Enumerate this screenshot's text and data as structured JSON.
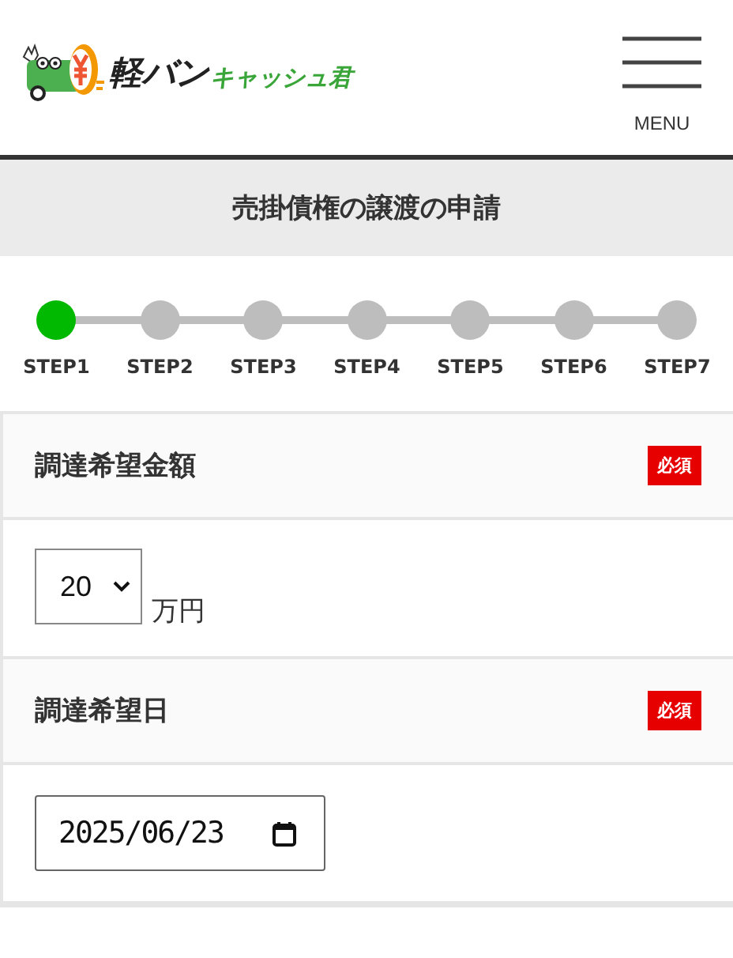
{
  "logo": {
    "title": "軽バン",
    "subtitle": "キャッシュ君"
  },
  "menu": {
    "label": "MENU"
  },
  "page_title": "売掛債権の譲渡の申請",
  "steps": [
    {
      "label": "STEP1",
      "selected": true
    },
    {
      "label": "STEP2",
      "selected": false
    },
    {
      "label": "STEP3",
      "selected": false
    },
    {
      "label": "STEP4",
      "selected": false
    },
    {
      "label": "STEP5",
      "selected": false
    },
    {
      "label": "STEP6",
      "selected": false
    },
    {
      "label": "STEP7",
      "selected": false
    }
  ],
  "fields": [
    {
      "kind": "select",
      "label": "調達希望金額",
      "badge": "必須",
      "value": "20",
      "unit": "万円"
    },
    {
      "kind": "date",
      "label": "調達希望日",
      "badge": "必須",
      "value": "2025/06/23"
    }
  ]
}
